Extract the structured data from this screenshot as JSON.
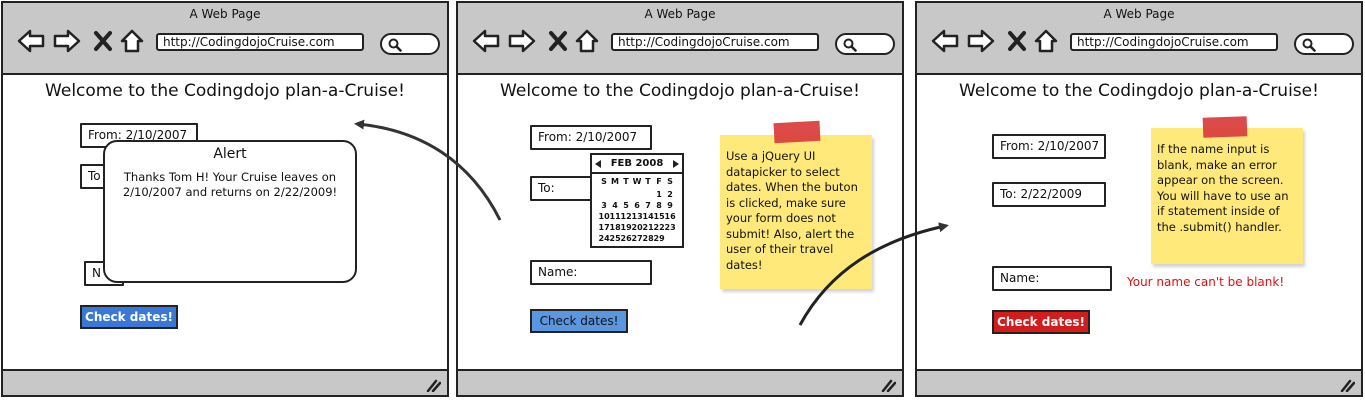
{
  "browser": {
    "window_title": "A Web Page",
    "url": "http://CodingdojoCruise.com",
    "nav_icons": [
      "back-arrow-icon",
      "forward-arrow-icon",
      "close-x-icon",
      "home-icon"
    ],
    "search_icon": "magnifier-icon"
  },
  "page": {
    "title": "Welcome to the Codingdojo plan-a-Cruise!"
  },
  "panel1": {
    "from_field": "From: 2/10/2007",
    "to_field": "To",
    "name_field": "N",
    "check_button": "Check dates!",
    "alert": {
      "title": "Alert",
      "body": "Thanks Tom H!  Your Cruise leaves on 2/10/2007 and returns on 2/22/2009!"
    }
  },
  "panel2": {
    "from_field": "From: 2/10/2007",
    "to_field": "To:",
    "name_field": "Name:",
    "check_button": "Check dates!",
    "calendar": {
      "month": "FEB 2008",
      "weekdays": [
        "S",
        "M",
        "T",
        "W",
        "T",
        "F",
        "S"
      ],
      "days": [
        "",
        "",
        "",
        "",
        "",
        "1",
        "2",
        "3",
        "4",
        "5",
        "6",
        "7",
        "8",
        "9",
        "10",
        "11",
        "12",
        "13",
        "14",
        "15",
        "16",
        "17",
        "18",
        "19",
        "20",
        "21",
        "22",
        "23",
        "24",
        "25",
        "26",
        "27",
        "28",
        "29"
      ]
    },
    "note": "Use a jQuery UI datapicker to select dates.  When the buton is clicked, make sure your form does not submit!  Also, alert the user of their travel dates!"
  },
  "panel3": {
    "from_field": "From: 2/10/2007",
    "to_field": "To: 2/22/2009",
    "name_field": "Name:",
    "check_button": "Check dates!",
    "error_message": "Your name can't be blank!",
    "note": "If the name input is blank, make an error appear on the screen. You will have to use an if statement inside of the .submit() handler."
  },
  "colors": {
    "chrome": "#c8c8c8",
    "button_blue": "#3a78d8",
    "button_blue_light": "#5b97e0",
    "button_red": "#d41c1c",
    "note_yellow": "#ffe97a",
    "tape_red": "#d93b3b",
    "error_red": "#dd1111"
  }
}
